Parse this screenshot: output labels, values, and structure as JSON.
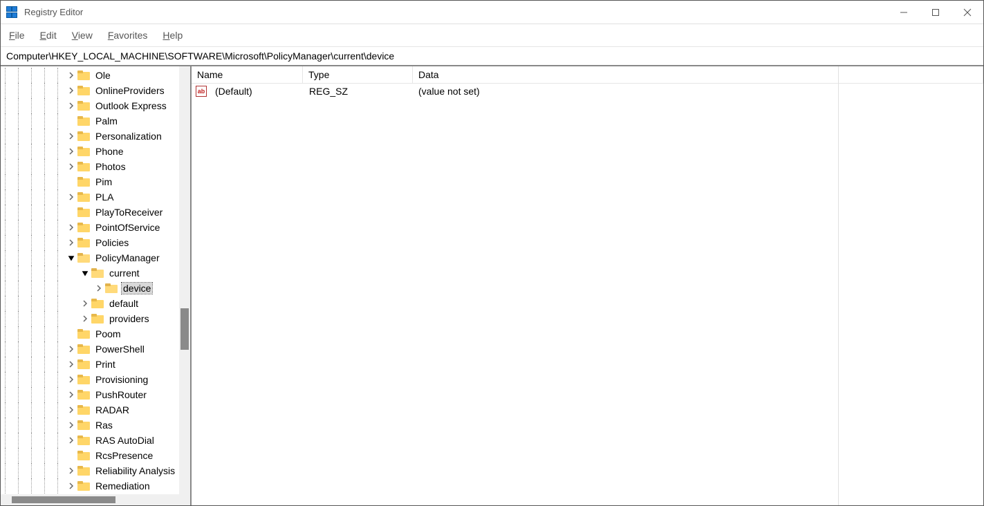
{
  "title": "Registry Editor",
  "menu": {
    "file": "File",
    "edit": "Edit",
    "view": "View",
    "favorites": "Favorites",
    "help": "Help"
  },
  "address": "Computer\\HKEY_LOCAL_MACHINE\\SOFTWARE\\Microsoft\\PolicyManager\\current\\device",
  "columns": {
    "name": "Name",
    "type": "Type",
    "data": "Data"
  },
  "value": {
    "name": "(Default)",
    "type": "REG_SZ",
    "data": "(value not set)"
  },
  "tree": [
    {
      "level": 5,
      "exp": ">",
      "label": "Ole"
    },
    {
      "level": 5,
      "exp": ">",
      "label": "OnlineProviders"
    },
    {
      "level": 5,
      "exp": ">",
      "label": "Outlook Express"
    },
    {
      "level": 5,
      "exp": "",
      "label": "Palm"
    },
    {
      "level": 5,
      "exp": ">",
      "label": "Personalization"
    },
    {
      "level": 5,
      "exp": ">",
      "label": "Phone"
    },
    {
      "level": 5,
      "exp": ">",
      "label": "Photos"
    },
    {
      "level": 5,
      "exp": "",
      "label": "Pim"
    },
    {
      "level": 5,
      "exp": ">",
      "label": "PLA"
    },
    {
      "level": 5,
      "exp": "",
      "label": "PlayToReceiver"
    },
    {
      "level": 5,
      "exp": ">",
      "label": "PointOfService"
    },
    {
      "level": 5,
      "exp": ">",
      "label": "Policies"
    },
    {
      "level": 5,
      "exp": "v",
      "label": "PolicyManager"
    },
    {
      "level": 6,
      "exp": "v",
      "label": "current"
    },
    {
      "level": 7,
      "exp": ">",
      "label": "device",
      "selected": true
    },
    {
      "level": 6,
      "exp": ">",
      "label": "default"
    },
    {
      "level": 6,
      "exp": ">",
      "label": "providers"
    },
    {
      "level": 5,
      "exp": "",
      "label": "Poom"
    },
    {
      "level": 5,
      "exp": ">",
      "label": "PowerShell"
    },
    {
      "level": 5,
      "exp": ">",
      "label": "Print"
    },
    {
      "level": 5,
      "exp": ">",
      "label": "Provisioning"
    },
    {
      "level": 5,
      "exp": ">",
      "label": "PushRouter"
    },
    {
      "level": 5,
      "exp": ">",
      "label": "RADAR"
    },
    {
      "level": 5,
      "exp": ">",
      "label": "Ras"
    },
    {
      "level": 5,
      "exp": ">",
      "label": "RAS AutoDial"
    },
    {
      "level": 5,
      "exp": "",
      "label": "RcsPresence"
    },
    {
      "level": 5,
      "exp": ">",
      "label": "Reliability Analysis"
    },
    {
      "level": 5,
      "exp": ">",
      "label": "Remediation"
    }
  ]
}
